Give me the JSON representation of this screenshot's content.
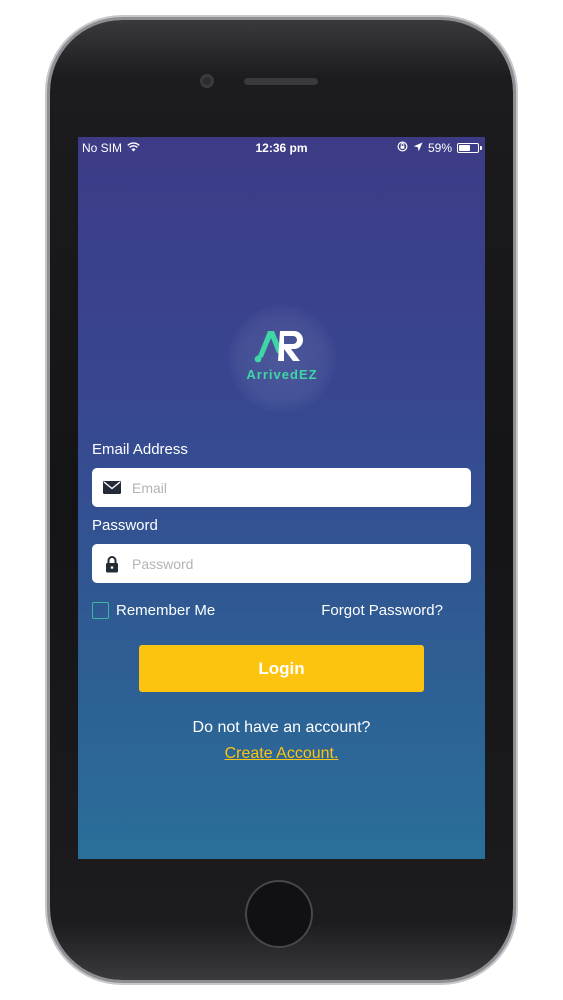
{
  "status_bar": {
    "carrier": "No SIM",
    "time": "12:36 pm",
    "battery_percent_label": "59%",
    "battery_level": 0.59
  },
  "app": {
    "name": "ArrivedEZ",
    "brand_color": "#3fd6a6",
    "accent_color": "#fdc40f"
  },
  "form": {
    "email_label": "Email Address",
    "email_placeholder": "Email",
    "email_value": "",
    "password_label": "Password",
    "password_placeholder": "Password",
    "password_value": "",
    "remember_label": "Remember Me",
    "remember_checked": false,
    "forgot_label": "Forgot Password?",
    "login_label": "Login"
  },
  "footer": {
    "prompt": "Do not have an account?",
    "create_link": "Create Account."
  },
  "icons": {
    "email": "envelope-icon",
    "password": "lock-icon",
    "wifi": "wifi-icon",
    "orientation_lock": "orientation-lock-icon",
    "location": "location-arrow-icon",
    "battery": "battery-icon"
  }
}
